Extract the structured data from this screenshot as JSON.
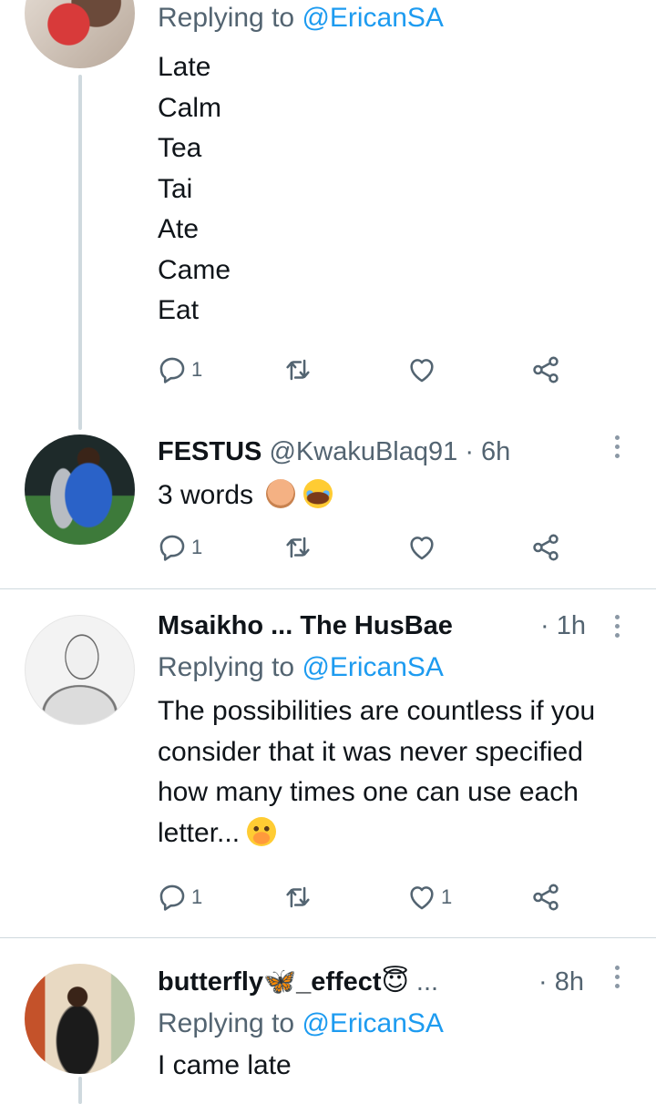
{
  "tweets": [
    {
      "replying_label": "Replying to",
      "replying_handle": "@EricanSA",
      "lines": [
        "Late",
        "Calm",
        "Tea",
        "Tai",
        "Ate",
        "Came",
        "Eat"
      ],
      "reply_count": "1",
      "like_count": ""
    },
    {
      "name": "FESTUS",
      "handle": "@KwakuBlaq91",
      "time": "· 6h",
      "text": "3 words",
      "emojis": [
        "facepalm-emoji",
        "laughing-crying-emoji"
      ],
      "reply_count": "1",
      "like_count": ""
    },
    {
      "name": "Msaikho ... The HusBae",
      "time": "· 1h",
      "replying_label": "Replying to",
      "replying_handle": "@EricanSA",
      "text": "The possibilities are countless if you consider that it was never specified how many times one can use each letter...",
      "emojis": [
        "hand-over-mouth-emoji"
      ],
      "reply_count": "1",
      "like_count": "1"
    },
    {
      "name": "butterfly🦋_effect😇",
      "name_suffix": "...",
      "time": "· 8h",
      "replying_label": "Replying to",
      "replying_handle": "@EricanSA",
      "text": "I came late"
    }
  ],
  "colors": {
    "link": "#1d9bf0",
    "secondary": "#536471",
    "divider": "#cfd9de"
  }
}
